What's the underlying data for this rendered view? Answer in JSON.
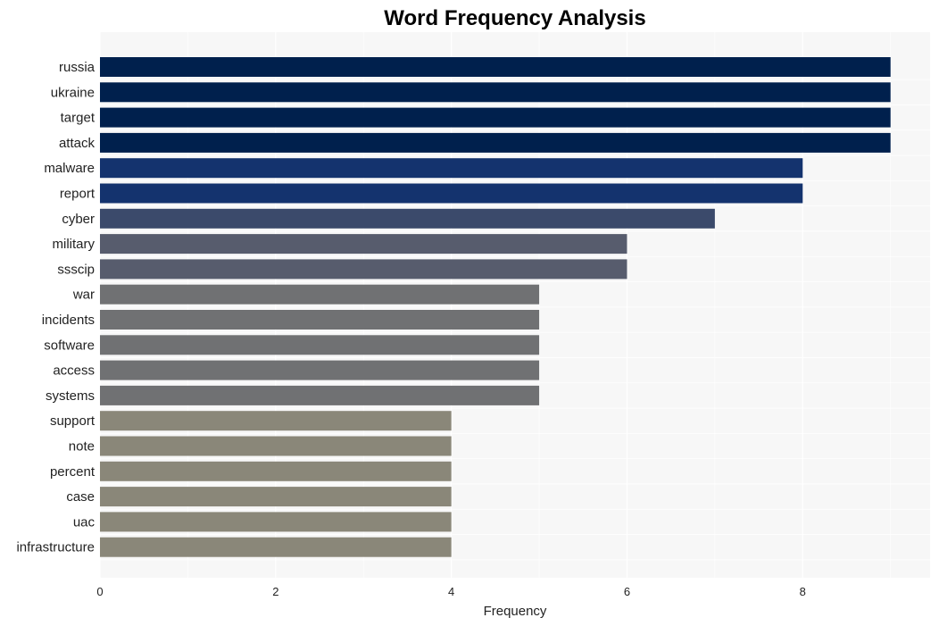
{
  "chart_data": {
    "type": "bar",
    "orientation": "horizontal",
    "title": "Word Frequency Analysis",
    "xlabel": "Frequency",
    "ylabel": "",
    "xlim": [
      0,
      9.45
    ],
    "xticks": [
      0,
      2,
      4,
      6,
      8
    ],
    "grid": true,
    "legend": "none",
    "categories": [
      "russia",
      "ukraine",
      "target",
      "attack",
      "malware",
      "report",
      "cyber",
      "military",
      "ssscip",
      "war",
      "incidents",
      "software",
      "access",
      "systems",
      "support",
      "note",
      "percent",
      "case",
      "uac",
      "infrastructure"
    ],
    "values": [
      9,
      9,
      9,
      9,
      8,
      8,
      7,
      6,
      6,
      5,
      5,
      5,
      5,
      5,
      4,
      4,
      4,
      4,
      4,
      4
    ],
    "colors": [
      "#00204d",
      "#00204d",
      "#00204d",
      "#00204d",
      "#14336e",
      "#14336e",
      "#3b4a6b",
      "#575c6d",
      "#575c6d",
      "#707173",
      "#707173",
      "#707173",
      "#707173",
      "#707173",
      "#8a8779",
      "#8a8779",
      "#8a8779",
      "#8a8779",
      "#8a8779",
      "#8a8779"
    ]
  },
  "style": {
    "plot_background": "#f7f7f7",
    "grid_color": "#ffffff"
  }
}
